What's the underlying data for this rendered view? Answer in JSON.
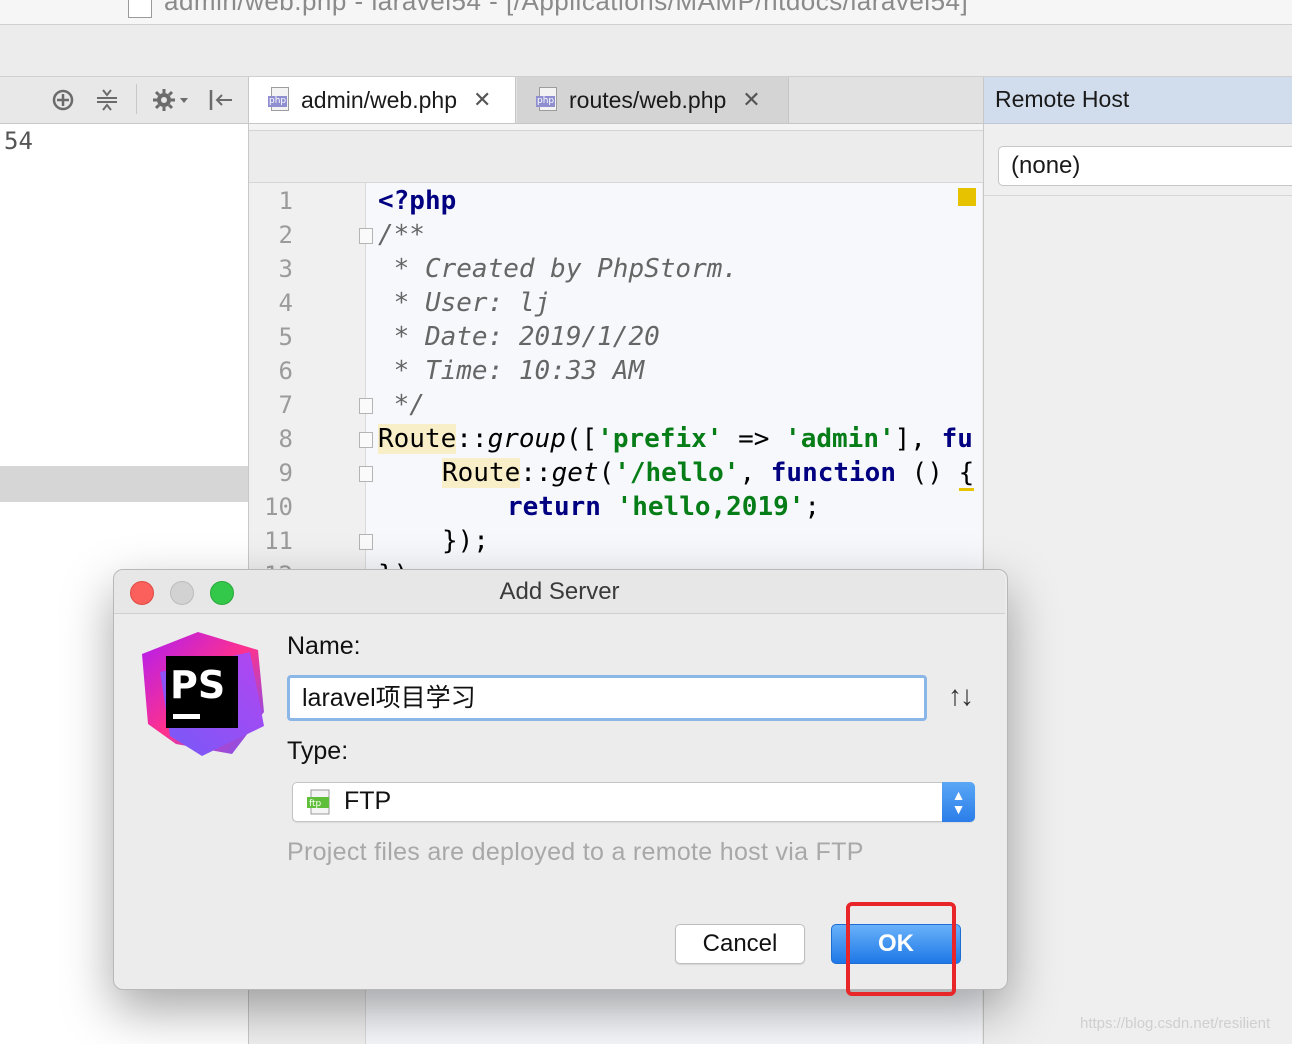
{
  "window": {
    "title": "admin/web.php - laravel54 - [/Applications/MAMP/htdocs/laravel54]"
  },
  "project_pane": {
    "visible_text": "54"
  },
  "editor": {
    "tabs": [
      {
        "label": "admin/web.php",
        "icon": "php-file-icon",
        "active": true
      },
      {
        "label": "routes/web.php",
        "icon": "php-file-icon",
        "active": false
      }
    ],
    "line_numbers": [
      "1",
      "2",
      "3",
      "4",
      "5",
      "6",
      "7",
      "8",
      "9",
      "10",
      "11",
      "12"
    ],
    "code": {
      "l1": "<?php",
      "l2": "/**",
      "l3": " * Created by PhpStorm.",
      "l4": " * User: lj",
      "l5": " * Date: 2019/1/20",
      "l6": " * Time: 10:33 AM",
      "l7": " */",
      "l8": {
        "cls": "Route",
        "op": "::",
        "fn": "group",
        "p1": "([",
        "s1": "'prefix'",
        "arrow": " => ",
        "s2": "'admin'",
        "p2": "], ",
        "kw": "fu"
      },
      "l9": {
        "cls": "Route",
        "op": "::",
        "fn": "get",
        "p1": "(",
        "s1": "'/hello'",
        "p2": ", ",
        "kw": "function",
        "p3": " () ",
        "brace": "{"
      },
      "l10": {
        "kw": "return",
        "s1": "'hello,2019'",
        "end": ";"
      },
      "l11": "});",
      "l12": "});"
    }
  },
  "remote_host_panel": {
    "title": "Remote Host",
    "selected": "(none)"
  },
  "dialog": {
    "title": "Add Server",
    "name_label": "Name:",
    "name_value": "laravel项目学习",
    "sort_icon": "↑↓",
    "type_label": "Type:",
    "type_value": "FTP",
    "type_icon_label": "ftp",
    "type_description": "Project files are deployed to a remote host via FTP",
    "cancel_label": "Cancel",
    "ok_label": "OK",
    "logo_text": "PS"
  },
  "watermark": "https://blog.csdn.net/resilient",
  "colors": {
    "ok_button": "#1e78e6",
    "highlight_box": "#e8262a",
    "keyword": "#000080",
    "string": "#067d17"
  }
}
